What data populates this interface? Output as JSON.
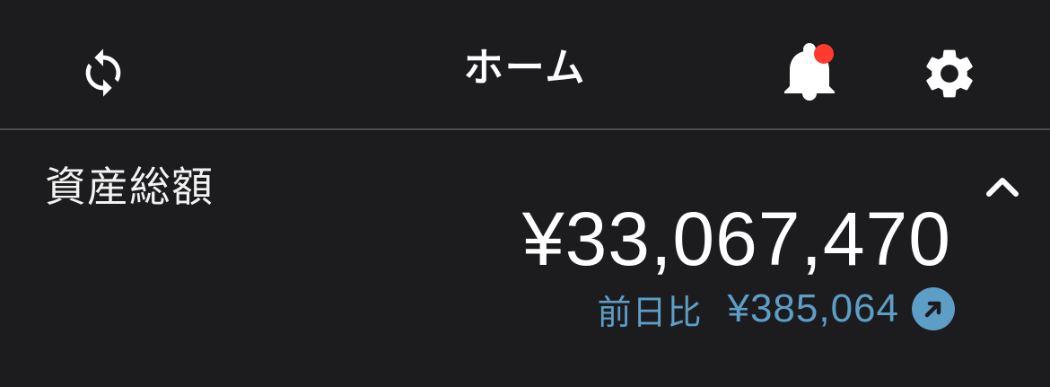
{
  "header": {
    "title": "ホーム",
    "left_icon": "sync-icon",
    "right_icons": [
      "bell-icon",
      "gear-icon"
    ],
    "notification_dot": true,
    "notification_color": "#ff3b30"
  },
  "assets": {
    "label": "資産総額",
    "total": "¥33,067,470",
    "change_label": "前日比",
    "change_value": "¥385,064",
    "change_direction": "up",
    "change_color": "#5d9ec6",
    "collapse_icon": "chevron-up-icon"
  }
}
